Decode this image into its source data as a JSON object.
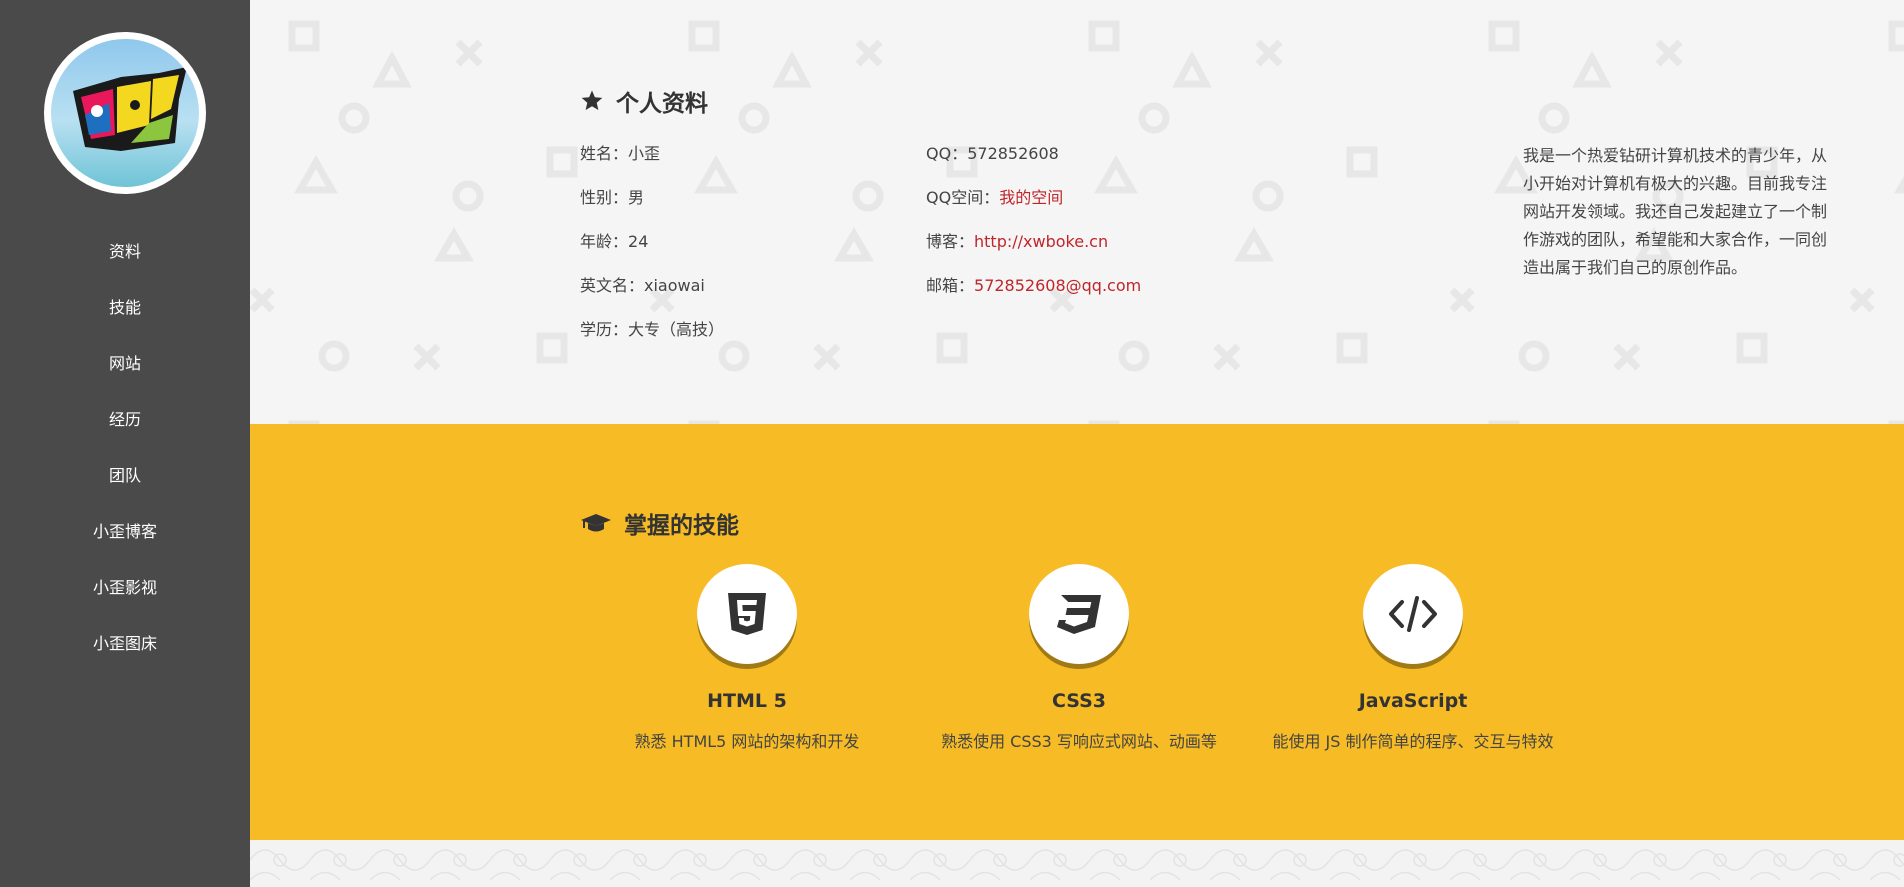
{
  "sidebar": {
    "avatar_alt": "logo",
    "items": [
      {
        "label": "资料"
      },
      {
        "label": "技能"
      },
      {
        "label": "网站"
      },
      {
        "label": "经历"
      },
      {
        "label": "团队"
      },
      {
        "label": "小歪博客"
      },
      {
        "label": "小歪影视"
      },
      {
        "label": "小歪图床"
      }
    ]
  },
  "profile": {
    "title": "个人资料",
    "title_icon": "star-icon",
    "col1": [
      {
        "label": "姓名：",
        "value": "小歪"
      },
      {
        "label": "性别：",
        "value": "男"
      },
      {
        "label": "年龄：",
        "value": "24"
      },
      {
        "label": "英文名：",
        "value": "xiaowai"
      },
      {
        "label": "学历：",
        "value": "大专（高技）"
      }
    ],
    "col2": [
      {
        "label": "QQ：",
        "value": "572852608"
      },
      {
        "label": "QQ空间：",
        "value": "我的空间"
      },
      {
        "label": "博客：",
        "value": "http://xwboke.cn"
      },
      {
        "label": "邮箱：",
        "value": "572852608@qq.com"
      }
    ],
    "bio": "我是一个热爱钻研计算机技术的青少年，从小开始对计算机有极大的兴趣。目前我专注网站开发领域。我还自己发起建立了一个制作游戏的团队，希望能和大家合作，一同创造出属于我们自己的原创作品。"
  },
  "skills": {
    "title": "掌握的技能",
    "title_icon": "graduation-cap-icon",
    "items": [
      {
        "name": "HTML 5",
        "desc": "熟悉 HTML5 网站的架构和开发",
        "icon": "html5-icon"
      },
      {
        "name": "CSS3",
        "desc": "熟悉使用 CSS3 写响应式网站、动画等",
        "icon": "css3-icon"
      },
      {
        "name": "JavaScript",
        "desc": "能使用 JS 制作简单的程序、交互与特效",
        "icon": "code-icon"
      }
    ]
  },
  "colors": {
    "sidebar": "#4a4a4a",
    "skills_bg": "#f7bc25",
    "link": "#c0252a"
  }
}
